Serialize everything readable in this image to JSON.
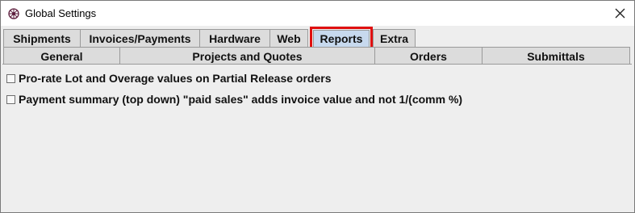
{
  "window": {
    "title": "Global Settings",
    "app_icon": "settings-gear-icon",
    "close_icon": "close-icon"
  },
  "tabs_primary": [
    {
      "label": "Shipments",
      "selected": false
    },
    {
      "label": "Invoices/Payments",
      "selected": false
    },
    {
      "label": "Hardware",
      "selected": false
    },
    {
      "label": "Web",
      "selected": false
    },
    {
      "label": "Reports",
      "selected": true
    },
    {
      "label": "Extra",
      "selected": false
    }
  ],
  "tabs_secondary": [
    {
      "label": "General"
    },
    {
      "label": "Projects and Quotes"
    },
    {
      "label": "Orders"
    },
    {
      "label": "Submittals"
    }
  ],
  "options": [
    {
      "label": "Pro-rate Lot and Overage values on Partial Release orders",
      "checked": false
    },
    {
      "label": "Payment summary (top down) \"paid sales\" adds invoice value and not 1/(comm %)",
      "checked": false
    }
  ],
  "colors": {
    "highlight_border": "#e01010",
    "selected_tab": "#c7d9ee"
  }
}
